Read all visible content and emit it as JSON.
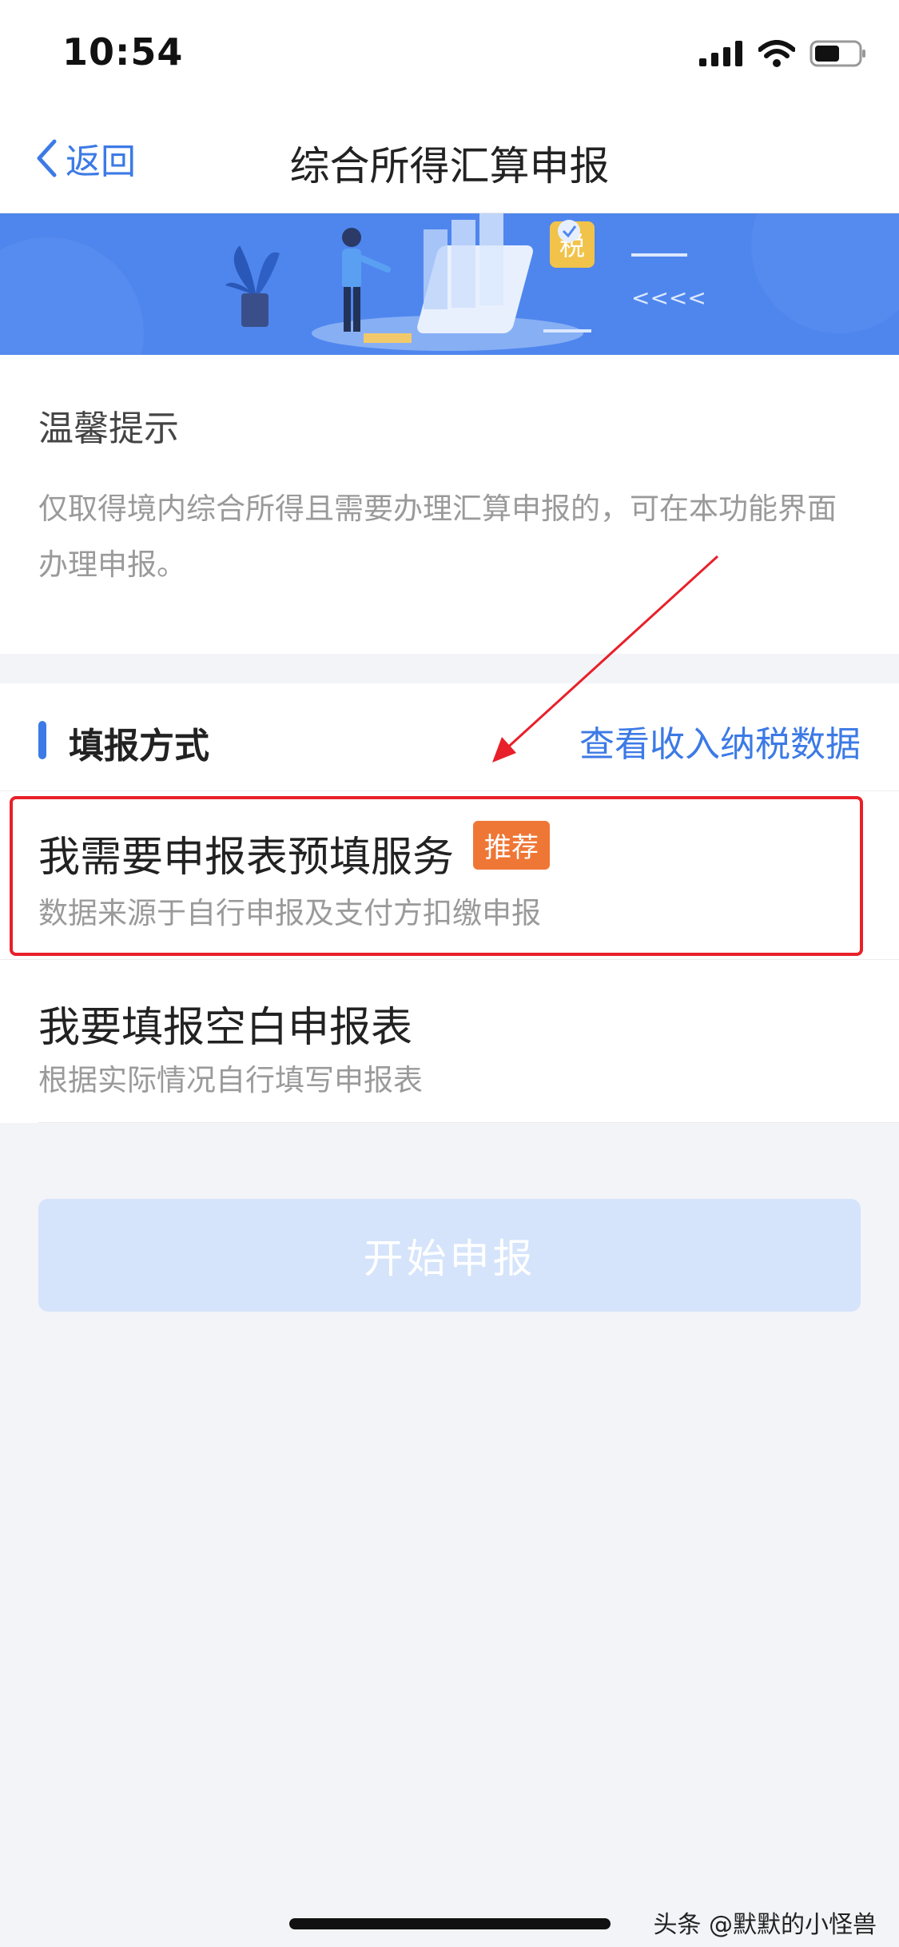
{
  "status_bar": {
    "time": "10:54",
    "icons": [
      "signal-icon",
      "wifi-icon",
      "battery-icon"
    ]
  },
  "nav": {
    "back_label": "返回",
    "title": "综合所得汇算申报"
  },
  "banner": {
    "badge_char": "税",
    "chevrons": "<<<<"
  },
  "tips": {
    "title": "温馨提示",
    "text": "仅取得境内综合所得且需要办理汇算申报的，可在本功能界面办理申报。"
  },
  "method": {
    "title": "填报方式",
    "view_data_link": "查看收入纳税数据",
    "options": [
      {
        "title": "我需要申报表预填服务",
        "badge": "推荐",
        "subtitle": "数据来源于自行申报及支付方扣缴申报"
      },
      {
        "title": "我要填报空白申报表",
        "subtitle": "根据实际情况自行填写申报表"
      }
    ]
  },
  "start_button": {
    "label": "开始申报"
  },
  "watermark": "头条 @默默的小怪兽",
  "colors": {
    "accent": "#3c7ae6",
    "badge": "#ef7736",
    "highlight": "#e8202a",
    "button_disabled": "#d5e4fb"
  }
}
